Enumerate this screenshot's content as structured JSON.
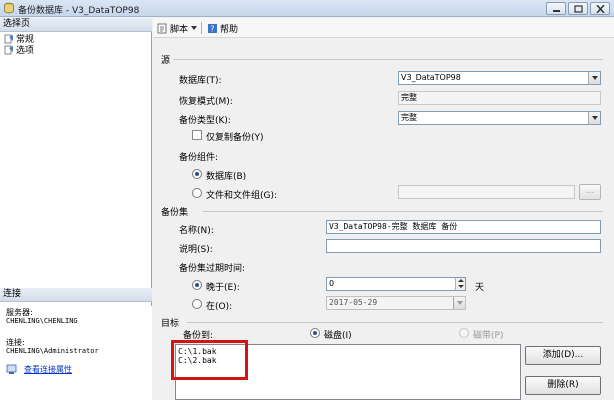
{
  "window": {
    "title": "备份数据库 - V3_DataTOP98"
  },
  "left": {
    "select_page_header": "选择页",
    "pages": [
      {
        "label": "常规"
      },
      {
        "label": "选项"
      }
    ],
    "connection_header": "连接",
    "server_label": "服务器:",
    "server_value": "CHENLING\\CHENLING",
    "connection_label": "连接:",
    "connection_value": "CHENLING\\Administrator",
    "view_connection_link": "查看连接属性"
  },
  "toolbar": {
    "script_label": "脚本",
    "help_label": "帮助"
  },
  "source": {
    "header": "源",
    "database_label": "数据库(T):",
    "database_value": "V3_DataTOP98",
    "recovery_label": "恢复模式(M):",
    "recovery_value": "完整",
    "backup_type_label": "备份类型(K):",
    "backup_type_value": "完整",
    "copy_only_label": "仅复制备份(Y)",
    "component_label": "备份组件:",
    "component_db_label": "数据库(B)",
    "component_files_label": "文件和文件组(G):",
    "files_button": "..."
  },
  "backup_set": {
    "header": "备份集",
    "name_label": "名称(N):",
    "name_value": "V3_DataTOP98-完整 数据库 备份",
    "desc_label": "说明(S):",
    "desc_value": "",
    "expire_label": "备份集过期时间:",
    "after_label": "晚于(E):",
    "after_value": "0",
    "days_label": "天",
    "on_label": "在(O):",
    "on_value": "2017-05-29"
  },
  "destination": {
    "header": "目标",
    "backup_to_label": "备份到:",
    "disk_label": "磁盘(I)",
    "tape_label": "磁带(P)",
    "paths": [
      "C:\\1.bak",
      "C:\\2.bak"
    ],
    "add_button": "添加(D)...",
    "remove_button": "删除(R)"
  },
  "colors": {
    "highlight": "#d41414",
    "link": "#0033cc"
  }
}
